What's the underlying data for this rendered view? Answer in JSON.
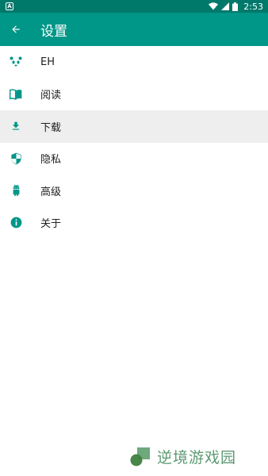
{
  "status_bar": {
    "time": "2:53",
    "notification_icon": "app-notification-icon",
    "icons": [
      "wifi-icon",
      "signal-icon",
      "battery-icon"
    ]
  },
  "app_bar": {
    "title": "设置",
    "back_icon": "arrow-back-icon"
  },
  "menu": [
    {
      "label": "EH",
      "icon": "panda-icon",
      "highlighted": false
    },
    {
      "label": "阅读",
      "icon": "book-icon",
      "highlighted": false
    },
    {
      "label": "下载",
      "icon": "download-icon",
      "highlighted": true
    },
    {
      "label": "隐私",
      "icon": "shield-icon",
      "highlighted": false
    },
    {
      "label": "高级",
      "icon": "android-icon",
      "highlighted": false
    },
    {
      "label": "关于",
      "icon": "info-icon",
      "highlighted": false
    }
  ],
  "watermark": {
    "text": "逆境游戏园"
  },
  "colors": {
    "primary": "#009688",
    "primary_dark": "#00796b",
    "icon": "#009688",
    "highlight": "#eeeeee"
  }
}
